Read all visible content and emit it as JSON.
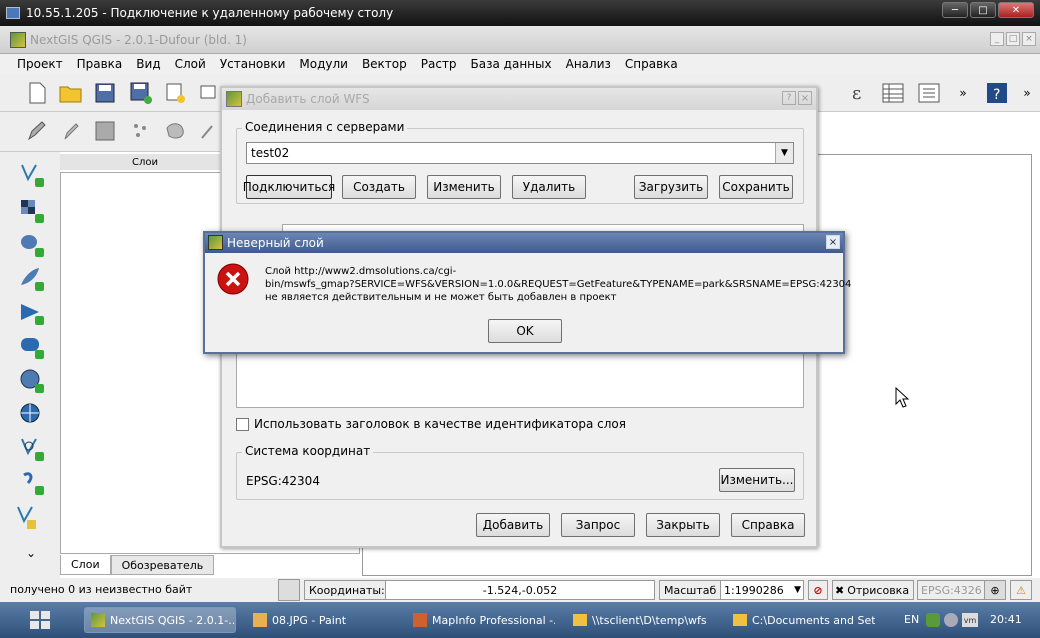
{
  "rdp": {
    "title": "10.55.1.205 - Подключение к удаленному рабочему столу"
  },
  "app": {
    "title": "NextGIS QGIS - 2.0.1-Dufour (bld. 1)"
  },
  "menu": [
    "Проект",
    "Правка",
    "Вид",
    "Слой",
    "Установки",
    "Модули",
    "Вектор",
    "Растр",
    "База данных",
    "Анализ",
    "Справка"
  ],
  "layers_panel": {
    "header": "Слои",
    "tabs": [
      "Слои",
      "Обозреватель"
    ]
  },
  "wfs_dialog": {
    "title": "Добавить слой WFS",
    "connections_label": "Соединения с серверами",
    "connection_selected": "test02",
    "buttons": {
      "connect": "Подключиться",
      "create": "Создать",
      "edit": "Изменить",
      "delete": "Удалить",
      "load": "Загрузить",
      "save": "Сохранить"
    },
    "checkbox_label": "Использовать заголовок в качестве идентификатора слоя",
    "crs_label": "Система координат",
    "crs_value": "EPSG:42304",
    "crs_change": "Изменить...",
    "bottom_buttons": {
      "add": "Добавить",
      "query": "Запрос",
      "close": "Закрыть",
      "help": "Справка"
    }
  },
  "error_dialog": {
    "title": "Неверный слой",
    "line1": "Слой http://www2.dmsolutions.ca/cgi-",
    "line2": "bin/mswfs_gmap?SERVICE=WFS&VERSION=1.0.0&REQUEST=GetFeature&TYPENAME=park&SRSNAME=EPSG:42304",
    "line3": "не является действительным и не может быть добавлен в проект",
    "ok": "OK"
  },
  "status": {
    "received": "получено 0 из  неизвестно байт",
    "coords_label": "Координаты:",
    "coords_value": "-1.524,-0.052",
    "scale_label": "Масштаб",
    "scale_value": "1:1990286",
    "render_label": "Отрисовка",
    "crs": "EPSG:4326"
  },
  "taskbar": {
    "items": [
      "NextGIS QGIS - 2.0.1-...",
      "08.JPG - Paint",
      "MapInfo Professional -...",
      "\\\\tsclient\\D\\temp\\wfs",
      "C:\\Documents and Set..."
    ],
    "lang": "EN",
    "time": "20:41"
  },
  "colors": {
    "error_red": "#cc1111",
    "taskbar": "#3a5f8e",
    "title_active": "#4a6aa0"
  }
}
